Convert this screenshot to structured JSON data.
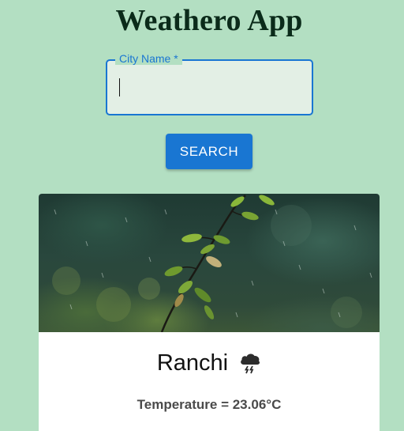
{
  "app": {
    "title": "Weathero App"
  },
  "search": {
    "label": "City Name *",
    "value": "",
    "button_label": "SEARCH"
  },
  "weather": {
    "city": "Ranchi",
    "condition_icon": "thunderstorm-cloud-icon",
    "temperature_text": "Temperature = 23.06°C"
  },
  "colors": {
    "background": "#b3dfc2",
    "accent": "#1976d2",
    "title": "#0b2b1a"
  }
}
